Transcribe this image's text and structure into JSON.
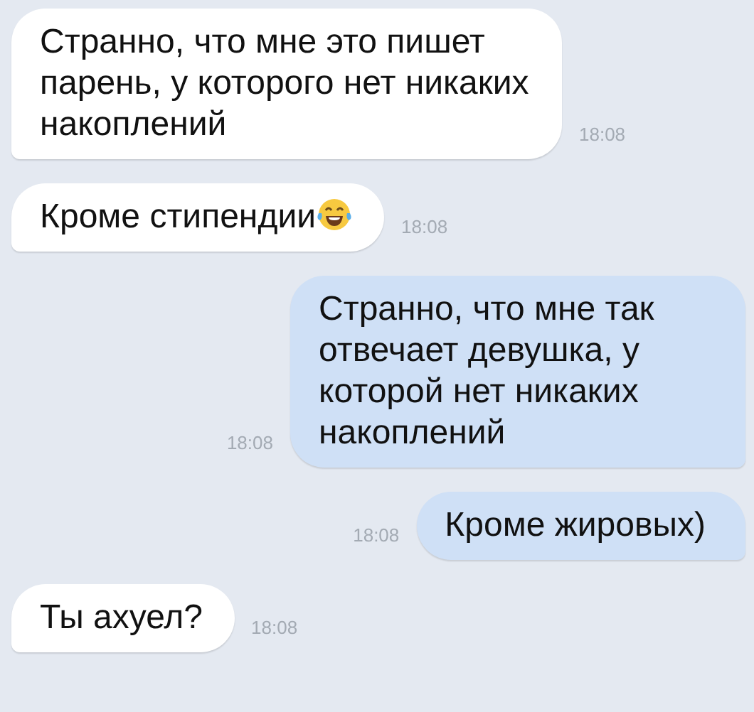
{
  "messages": [
    {
      "kind": "incoming",
      "text": "Странно, что мне это пишет парень, у которого нет никаких накоплений",
      "emoji": false,
      "time": "18:08"
    },
    {
      "kind": "incoming",
      "text": "Кроме стипендии",
      "emoji": true,
      "time": "18:08"
    },
    {
      "kind": "outgoing",
      "text": "Странно, что мне так отвечает девушка, у которой нет никаких накоплений",
      "emoji": false,
      "time": "18:08"
    },
    {
      "kind": "outgoing",
      "text": "Кроме жировых)",
      "emoji": false,
      "time": "18:08"
    },
    {
      "kind": "incoming",
      "text": "Ты ахуел?",
      "emoji": false,
      "time": "18:08"
    }
  ]
}
